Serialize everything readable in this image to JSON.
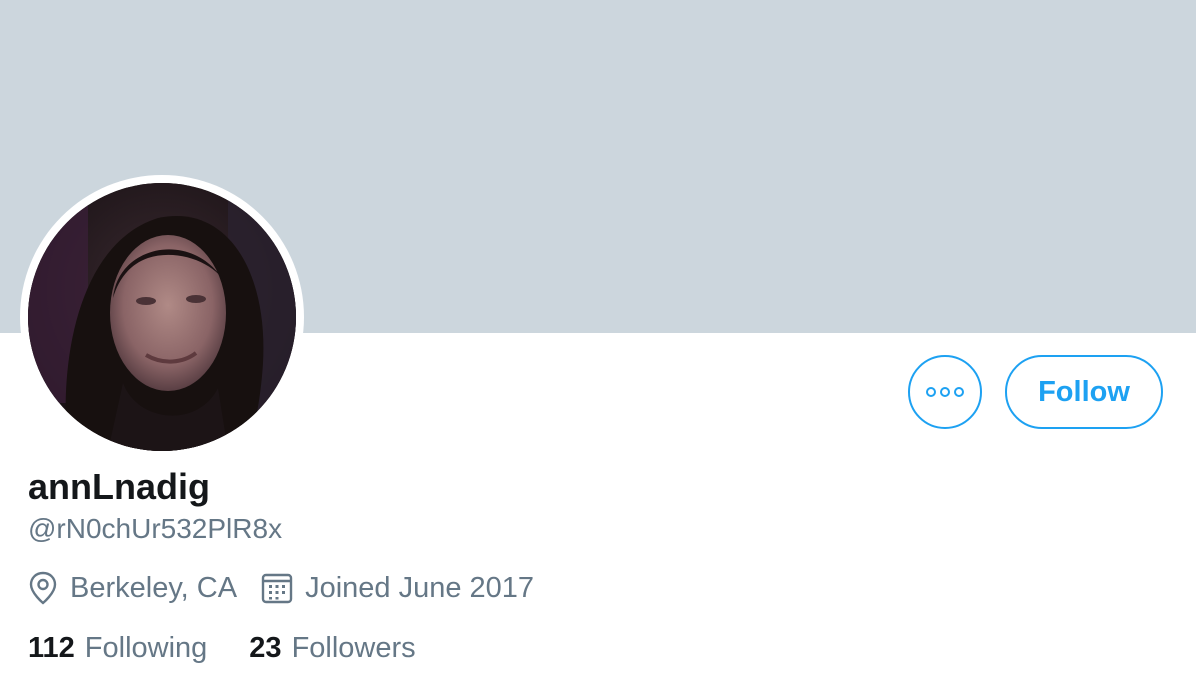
{
  "profile": {
    "display_name": "annLnadig",
    "handle": "@rN0chUr532PlR8x",
    "location": "Berkeley, CA",
    "joined": "Joined June 2017"
  },
  "actions": {
    "follow_label": "Follow",
    "more_icon": "ellipsis-icon"
  },
  "stats": {
    "following_count": "112",
    "following_label": "Following",
    "followers_count": "23",
    "followers_label": "Followers"
  },
  "colors": {
    "accent": "#1da1f2",
    "banner": "#ccd6dd",
    "secondary_text": "#657786",
    "primary_text": "#14171a"
  }
}
